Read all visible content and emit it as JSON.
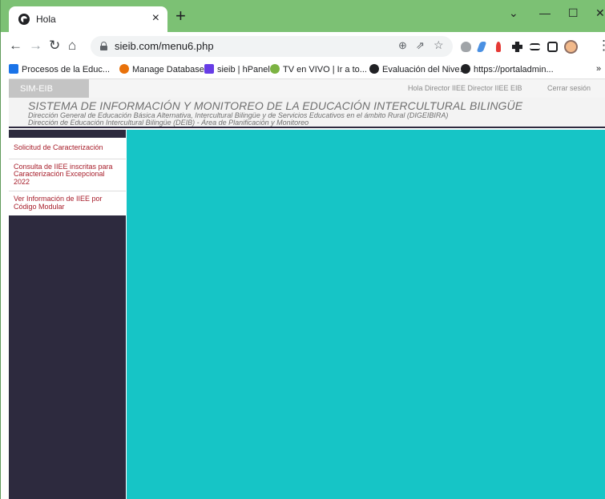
{
  "browser": {
    "tab_title": "Hola",
    "tab_close": "×",
    "new_tab": "+",
    "window_controls": {
      "dropdown": "⌄",
      "minimize": "—",
      "maximize": "☐",
      "close": "✕"
    },
    "nav": {
      "back": "←",
      "forward": "→",
      "reload": "↻",
      "home": "⌂"
    },
    "address": "sieib.com/menu6.php",
    "omnibox_icons": {
      "zoom": "⊕",
      "share": "⇗",
      "star": "☆"
    },
    "menu_dots": "⋮"
  },
  "bookmarks": [
    {
      "label": "Procesos de la Educ...",
      "icon_color": "#1a73e8"
    },
    {
      "label": "Manage Databases",
      "icon_color": "#e8710a"
    },
    {
      "label": "sieib | hPanel",
      "icon_color": "#673de6"
    },
    {
      "label": "TV en VIVO | Ir a to...",
      "icon_color": "#7cb342"
    },
    {
      "label": "Evaluación del Nive...",
      "icon_color": "#202124"
    },
    {
      "label": "https://portaladmin...",
      "icon_color": "#202124"
    }
  ],
  "bookmarks_more": "»",
  "topbar": {
    "brand": "SIM-EIB",
    "greeting": "Hola Director IIEE Director IIEE EIB",
    "logout": "Cerrar sesión"
  },
  "header": {
    "title": "SISTEMA DE INFORMACIÓN Y MONITOREO DE LA EDUCACIÓN INTERCULTURAL BILINGÜE",
    "line2": "Dirección General de Educación Básica Alternativa, Intercultural Bilingüe y de Servicios Educativos en el ámbito Rural (DIGEIBIRA)",
    "line3": "Dirección de Educación Intercultural Bilingüe (DEIB) - Área de Planificación y Monitoreo"
  },
  "menu": [
    "Solicitud de Caracterización",
    "Consulta de IIEE inscritas para Caracterización Excepcional 2022",
    "Ver Información de IIEE por Código Modular"
  ],
  "colors": {
    "tabstrip": "#7cc174",
    "sidebar": "#2d2a3e",
    "content": "#16c5c6",
    "menu_link": "#a71d2a"
  }
}
